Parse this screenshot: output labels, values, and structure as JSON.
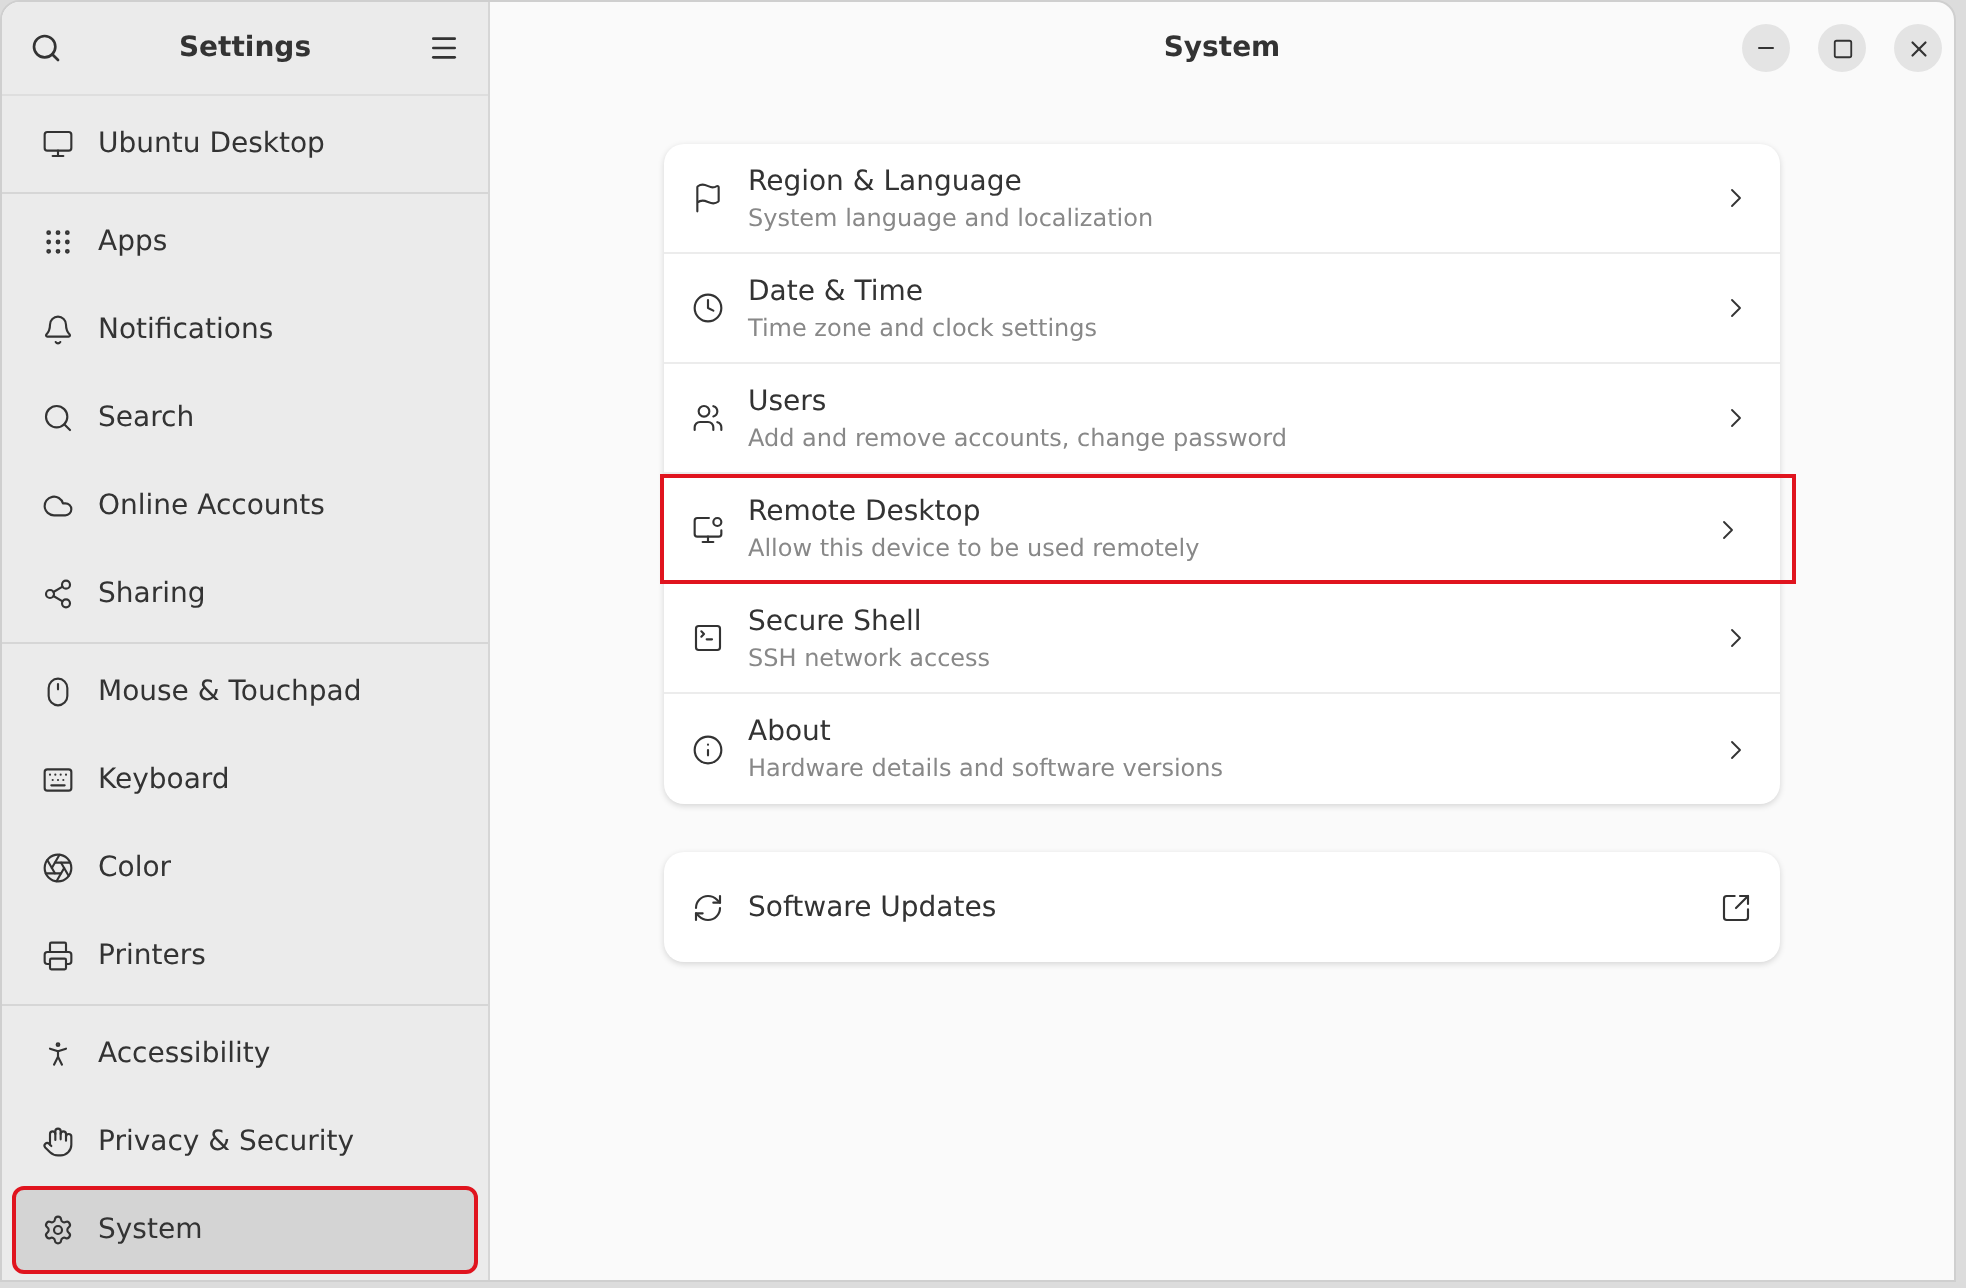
{
  "sidebar": {
    "title": "Settings",
    "groups": [
      [
        {
          "label": "Ubuntu Desktop",
          "selected": false,
          "highlighted": false
        }
      ],
      [
        {
          "label": "Apps",
          "selected": false,
          "highlighted": false
        },
        {
          "label": "Notifications",
          "selected": false,
          "highlighted": false
        },
        {
          "label": "Search",
          "selected": false,
          "highlighted": false
        },
        {
          "label": "Online Accounts",
          "selected": false,
          "highlighted": false
        },
        {
          "label": "Sharing",
          "selected": false,
          "highlighted": false
        }
      ],
      [
        {
          "label": "Mouse & Touchpad",
          "selected": false,
          "highlighted": false
        },
        {
          "label": "Keyboard",
          "selected": false,
          "highlighted": false
        },
        {
          "label": "Color",
          "selected": false,
          "highlighted": false
        },
        {
          "label": "Printers",
          "selected": false,
          "highlighted": false
        }
      ],
      [
        {
          "label": "Accessibility",
          "selected": false,
          "highlighted": false
        },
        {
          "label": "Privacy & Security",
          "selected": false,
          "highlighted": false
        },
        {
          "label": "System",
          "selected": true,
          "highlighted": true
        }
      ]
    ]
  },
  "content": {
    "title": "System",
    "panels": [
      {
        "title": "Region & Language",
        "subtitle": "System language and localization",
        "highlighted": false
      },
      {
        "title": "Date & Time",
        "subtitle": "Time zone and clock settings",
        "highlighted": false
      },
      {
        "title": "Users",
        "subtitle": "Add and remove accounts, change password",
        "highlighted": false
      },
      {
        "title": "Remote Desktop",
        "subtitle": "Allow this device to be used remotely",
        "highlighted": true
      },
      {
        "title": "Secure Shell",
        "subtitle": "SSH network access",
        "highlighted": false
      },
      {
        "title": "About",
        "subtitle": "Hardware details and software versions",
        "highlighted": false
      }
    ],
    "external": {
      "title": "Software Updates"
    }
  }
}
